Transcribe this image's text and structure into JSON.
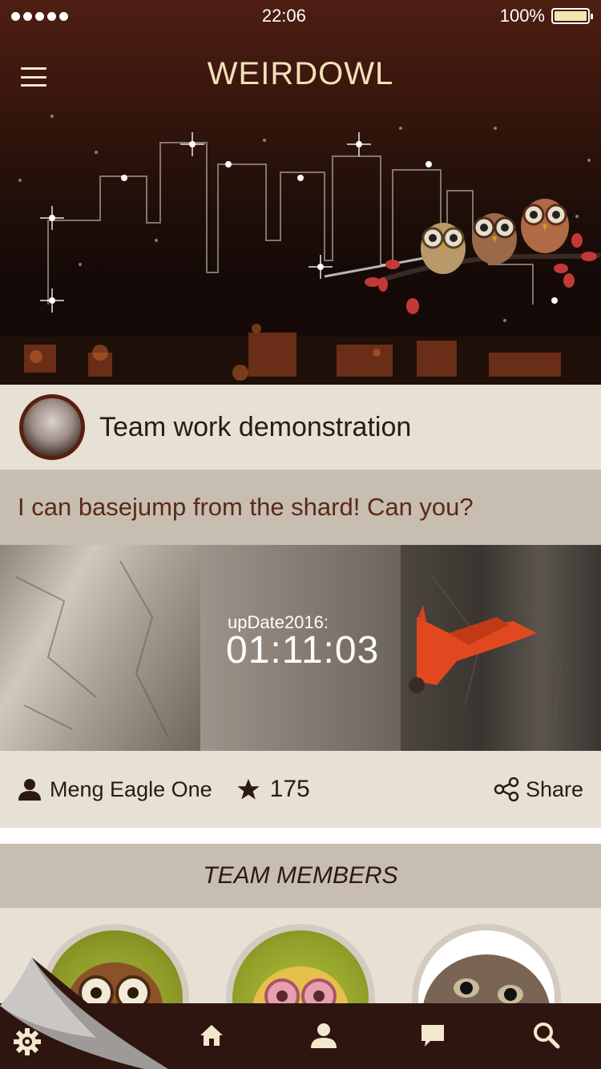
{
  "status_bar": {
    "time": "22:06",
    "battery": "100%",
    "battery_level": 1.0
  },
  "header": {
    "title": "WEIRDOWL"
  },
  "post": {
    "title": "Team work demonstration",
    "caption": "I can basejump from the shard! Can you?",
    "update_label": "upDate2016:",
    "timer": "01:11:03",
    "author": "Meng Eagle One",
    "stars": "175",
    "share_label": "Share"
  },
  "team": {
    "title": "TEAM MEMBERS"
  },
  "icons": {
    "menu": "menu-icon",
    "user": "user-icon",
    "star": "star-icon",
    "share": "share-icon",
    "settings": "gear-icon",
    "home": "home-icon",
    "profile": "profile-icon",
    "chat": "chat-icon",
    "search": "search-icon"
  },
  "colors": {
    "brand_dark": "#2e1510",
    "accent": "#5a2a16",
    "title_gold": "#f3e1b8"
  }
}
